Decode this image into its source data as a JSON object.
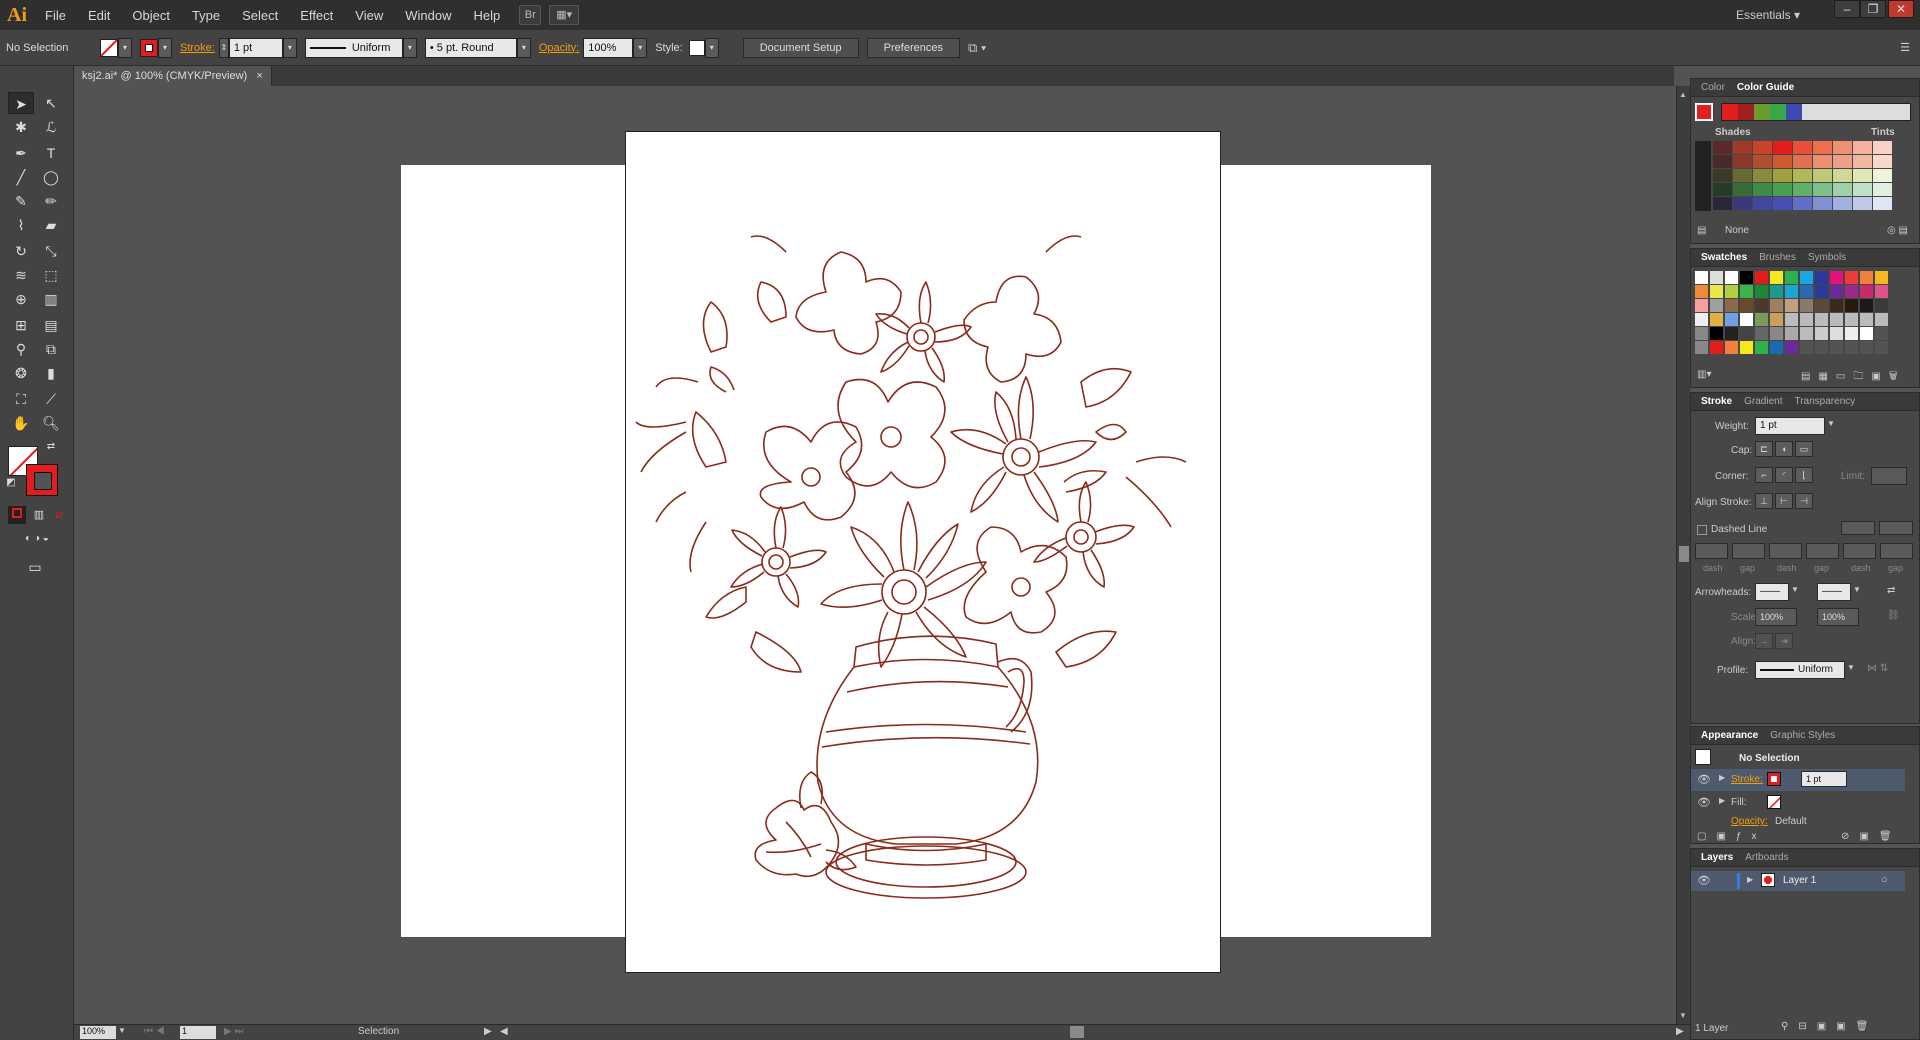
{
  "app": {
    "logo": "Ai",
    "menus": [
      "File",
      "Edit",
      "Object",
      "Type",
      "Select",
      "Effect",
      "View",
      "Window",
      "Help"
    ],
    "workspace": "Essentials"
  },
  "control": {
    "selection": "No Selection",
    "stroke_label": "Stroke:",
    "stroke_weight": "1 pt",
    "profile": "Uniform",
    "brush": "5 pt. Round",
    "opacity_label": "Opacity:",
    "opacity": "100%",
    "style_label": "Style:",
    "doc_setup": "Document Setup",
    "preferences": "Preferences"
  },
  "document": {
    "tab": "ksj2.ai* @ 100% (CMYK/Preview)",
    "close": "×"
  },
  "status": {
    "zoom": "100%",
    "artboard": "1",
    "tool": "Selection"
  },
  "color_panel": {
    "tabs": [
      "Color",
      "Color Guide"
    ],
    "shades": "Shades",
    "tints": "Tints",
    "none": "None"
  },
  "swatches_panel": {
    "tabs": [
      "Swatches",
      "Brushes",
      "Symbols"
    ]
  },
  "stroke_panel": {
    "tabs": [
      "Stroke",
      "Gradient",
      "Transparency"
    ],
    "weight_label": "Weight:",
    "weight": "1 pt",
    "cap_label": "Cap:",
    "corner_label": "Corner:",
    "limit_label": "Limit:",
    "align_label": "Align Stroke:",
    "dashed": "Dashed Line",
    "dash_labels": [
      "dash",
      "gap",
      "dash",
      "gap",
      "dash",
      "gap"
    ],
    "arrowheads_label": "Arrowheads:",
    "scale_label": "Scale:",
    "scale1": "100%",
    "scale2": "100%",
    "align2_label": "Align:",
    "profile_label": "Profile:",
    "profile": "Uniform"
  },
  "appearance_panel": {
    "tabs": [
      "Appearance",
      "Graphic Styles"
    ],
    "title": "No Selection",
    "stroke_label": "Stroke:",
    "stroke_weight": "1 pt",
    "fill_label": "Fill:",
    "opacity_label": "Opacity:",
    "opacity": "Default"
  },
  "layers_panel": {
    "tabs": [
      "Layers",
      "Artboards"
    ],
    "layer": "Layer 1",
    "count": "1 Layer"
  },
  "colors": {
    "accent": "#f39c12",
    "stroke_red": "#e21d1d",
    "art_line": "#8b2a1a"
  }
}
